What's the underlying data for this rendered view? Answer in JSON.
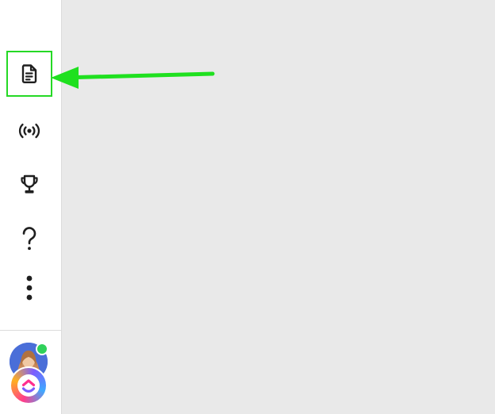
{
  "sidebar": {
    "items": [
      {
        "icon": "document-icon",
        "name": "sidebar-item-docs",
        "highlighted": true
      },
      {
        "icon": "broadcast-icon",
        "name": "sidebar-item-live"
      },
      {
        "icon": "trophy-icon",
        "name": "sidebar-item-goals"
      },
      {
        "icon": "help-icon",
        "name": "sidebar-item-help"
      },
      {
        "icon": "more-vertical-icon",
        "name": "sidebar-item-more"
      }
    ]
  },
  "user": {
    "status": "online",
    "status_color": "#2fd15a"
  },
  "annotation": {
    "highlight_color": "#25d925",
    "arrow_color": "#1fe01f"
  },
  "colors": {
    "sidebar_bg": "#ffffff",
    "main_bg": "#e9e9e9",
    "icon": "#1f1f1f"
  }
}
